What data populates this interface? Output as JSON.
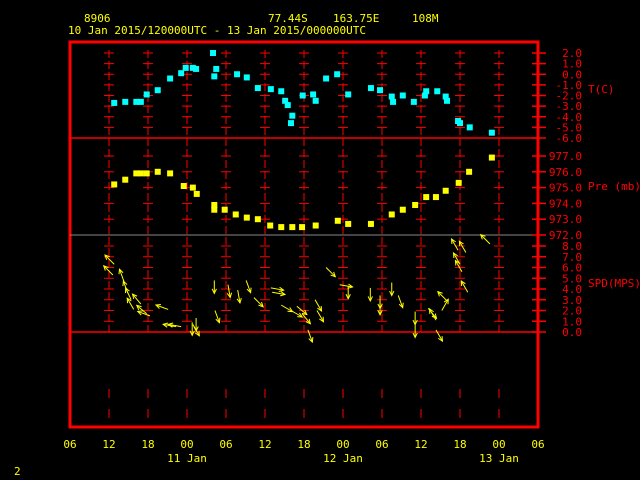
{
  "header": {
    "station": "8906",
    "lat": "77.44S",
    "lon": "163.75E",
    "elev": "108M",
    "period": "10 Jan 2015/120000UTC - 13 Jan 2015/000000UTC"
  },
  "page_number": "2",
  "colors": {
    "frame": "#ff0000",
    "temp": "#00ffff",
    "pressure": "#ffff00",
    "wind": "#ffff00",
    "text": "#ffff00"
  },
  "chart_data": [
    {
      "type": "scatter",
      "title": "T(C)",
      "ylabel": "T(C)",
      "ylim": [
        -6,
        2
      ],
      "yticks": [
        "2.0",
        "1.0",
        "0.0",
        "-1.0",
        "-2.0",
        "-3.0",
        "-4.0",
        "-5.0",
        "-6.0"
      ],
      "x_units": "hours since 10 Jan 06UTC",
      "points": [
        [
          6.8,
          -2.7
        ],
        [
          8.5,
          -2.6
        ],
        [
          10.2,
          -2.6
        ],
        [
          10.9,
          -2.6
        ],
        [
          11.8,
          -1.9
        ],
        [
          13.5,
          -1.5
        ],
        [
          15.4,
          -0.4
        ],
        [
          17.1,
          0.1
        ],
        [
          17.8,
          0.6
        ],
        [
          18.9,
          0.6
        ],
        [
          19.4,
          0.5
        ],
        [
          22.0,
          2.0
        ],
        [
          22.2,
          -0.2
        ],
        [
          22.5,
          0.5
        ],
        [
          25.7,
          0.0
        ],
        [
          27.2,
          -0.3
        ],
        [
          28.9,
          -1.3
        ],
        [
          30.9,
          -1.4
        ],
        [
          32.5,
          -1.6
        ],
        [
          33.1,
          -2.5
        ],
        [
          33.5,
          -2.9
        ],
        [
          34.2,
          -3.9
        ],
        [
          34.0,
          -4.6
        ],
        [
          35.8,
          -2.0
        ],
        [
          37.4,
          -1.9
        ],
        [
          37.8,
          -2.5
        ],
        [
          39.4,
          -0.4
        ],
        [
          41.1,
          0.0
        ],
        [
          42.8,
          -1.9
        ],
        [
          46.3,
          -1.3
        ],
        [
          47.7,
          -1.5
        ],
        [
          49.5,
          -2.1
        ],
        [
          49.7,
          -2.6
        ],
        [
          51.2,
          -2.0
        ],
        [
          52.9,
          -2.6
        ],
        [
          54.6,
          -2.0
        ],
        [
          54.8,
          -1.6
        ],
        [
          56.5,
          -1.6
        ],
        [
          57.8,
          -2.1
        ],
        [
          58.0,
          -2.5
        ],
        [
          59.7,
          -4.4
        ],
        [
          60.0,
          -4.6
        ],
        [
          61.5,
          -5.0
        ],
        [
          64.9,
          -5.5
        ]
      ]
    },
    {
      "type": "scatter",
      "title": "Pre (mb)",
      "ylabel": "Pre (mb)",
      "ylim": [
        972,
        977
      ],
      "yticks": [
        "977.0",
        "976.0",
        "975.0",
        "974.0",
        "973.0",
        "972.0"
      ],
      "points": [
        [
          6.8,
          975.2
        ],
        [
          8.5,
          975.5
        ],
        [
          10.2,
          975.9
        ],
        [
          10.9,
          975.9
        ],
        [
          11.8,
          975.9
        ],
        [
          13.5,
          976.0
        ],
        [
          15.4,
          975.9
        ],
        [
          17.5,
          975.1
        ],
        [
          18.9,
          975.0
        ],
        [
          19.5,
          974.6
        ],
        [
          22.2,
          973.9
        ],
        [
          22.2,
          973.6
        ],
        [
          23.8,
          973.6
        ],
        [
          25.5,
          973.3
        ],
        [
          27.2,
          973.1
        ],
        [
          28.9,
          973.0
        ],
        [
          30.8,
          972.6
        ],
        [
          32.5,
          972.5
        ],
        [
          34.2,
          972.5
        ],
        [
          35.7,
          972.5
        ],
        [
          37.8,
          972.6
        ],
        [
          41.2,
          972.9
        ],
        [
          42.8,
          972.7
        ],
        [
          46.3,
          972.7
        ],
        [
          49.5,
          973.3
        ],
        [
          51.2,
          973.6
        ],
        [
          53.1,
          973.9
        ],
        [
          54.8,
          974.4
        ],
        [
          56.3,
          974.4
        ],
        [
          57.8,
          974.8
        ],
        [
          59.8,
          975.3
        ],
        [
          61.4,
          976.0
        ],
        [
          64.9,
          976.9
        ]
      ]
    },
    {
      "type": "vector",
      "title": "SPD(MPS)",
      "ylabel": "SPD(MPS)",
      "ylim": [
        0,
        8
      ],
      "yticks": [
        "8.0",
        "7.0",
        "6.0",
        "5.0",
        "4.0",
        "3.0",
        "2.0",
        "1.0",
        "0.0"
      ],
      "arrows_note": "[hours, speed, arrow bearing deg]",
      "arrows": [
        [
          6.8,
          6.3,
          -45
        ],
        [
          6.6,
          5.3,
          -45
        ],
        [
          8.3,
          4.7,
          -20
        ],
        [
          8.9,
          3.6,
          -20
        ],
        [
          9.4,
          3.0,
          -25
        ],
        [
          9.8,
          2.1,
          -30
        ],
        [
          10.9,
          2.6,
          -40
        ],
        [
          11.8,
          1.7,
          -50
        ],
        [
          12.3,
          1.5,
          -70
        ],
        [
          15.1,
          2.1,
          -70
        ],
        [
          16.3,
          0.5,
          -80
        ],
        [
          17.1,
          0.5,
          -80
        ],
        [
          18.8,
          0.9,
          180
        ],
        [
          19.4,
          1.3,
          180
        ],
        [
          18.9,
          0.7,
          150
        ],
        [
          22.2,
          4.8,
          180
        ],
        [
          22.3,
          2.0,
          160
        ],
        [
          24.3,
          4.4,
          170
        ],
        [
          25.8,
          3.9,
          170
        ],
        [
          27.1,
          4.8,
          160
        ],
        [
          28.3,
          3.2,
          135
        ],
        [
          30.9,
          4.1,
          100
        ],
        [
          31.1,
          3.7,
          100
        ],
        [
          32.5,
          2.5,
          120
        ],
        [
          34.0,
          2.0,
          120
        ],
        [
          34.9,
          2.4,
          130
        ],
        [
          35.7,
          1.7,
          140
        ],
        [
          36.6,
          0.2,
          160
        ],
        [
          37.7,
          3.0,
          150
        ],
        [
          38.0,
          2.0,
          150
        ],
        [
          39.4,
          6.0,
          135
        ],
        [
          41.5,
          4.4,
          100
        ],
        [
          42.8,
          4.3,
          180
        ],
        [
          46.2,
          4.1,
          180
        ],
        [
          47.7,
          3.4,
          180
        ],
        [
          47.7,
          2.8,
          180
        ],
        [
          49.5,
          4.6,
          180
        ],
        [
          50.5,
          3.4,
          160
        ],
        [
          53.1,
          1.9,
          180
        ],
        [
          53.1,
          0.7,
          180
        ],
        [
          55.1,
          2.2,
          140
        ],
        [
          56.3,
          0.2,
          150
        ],
        [
          56.3,
          1.1,
          -30
        ],
        [
          57.2,
          2.0,
          30
        ],
        [
          58.0,
          2.9,
          -45
        ],
        [
          59.7,
          7.6,
          -30
        ],
        [
          60.9,
          7.4,
          -30
        ],
        [
          60.3,
          5.6,
          -30
        ],
        [
          60.0,
          6.3,
          -30
        ],
        [
          61.2,
          3.7,
          -30
        ],
        [
          64.6,
          8.2,
          -45
        ]
      ]
    }
  ],
  "x_axis": {
    "hour_labels": [
      "06",
      "12",
      "18",
      "00",
      "06",
      "12",
      "18",
      "00",
      "06",
      "12",
      "18",
      "00",
      "06"
    ],
    "day_labels": [
      "11 Jan",
      "12 Jan",
      "13 Jan"
    ]
  }
}
